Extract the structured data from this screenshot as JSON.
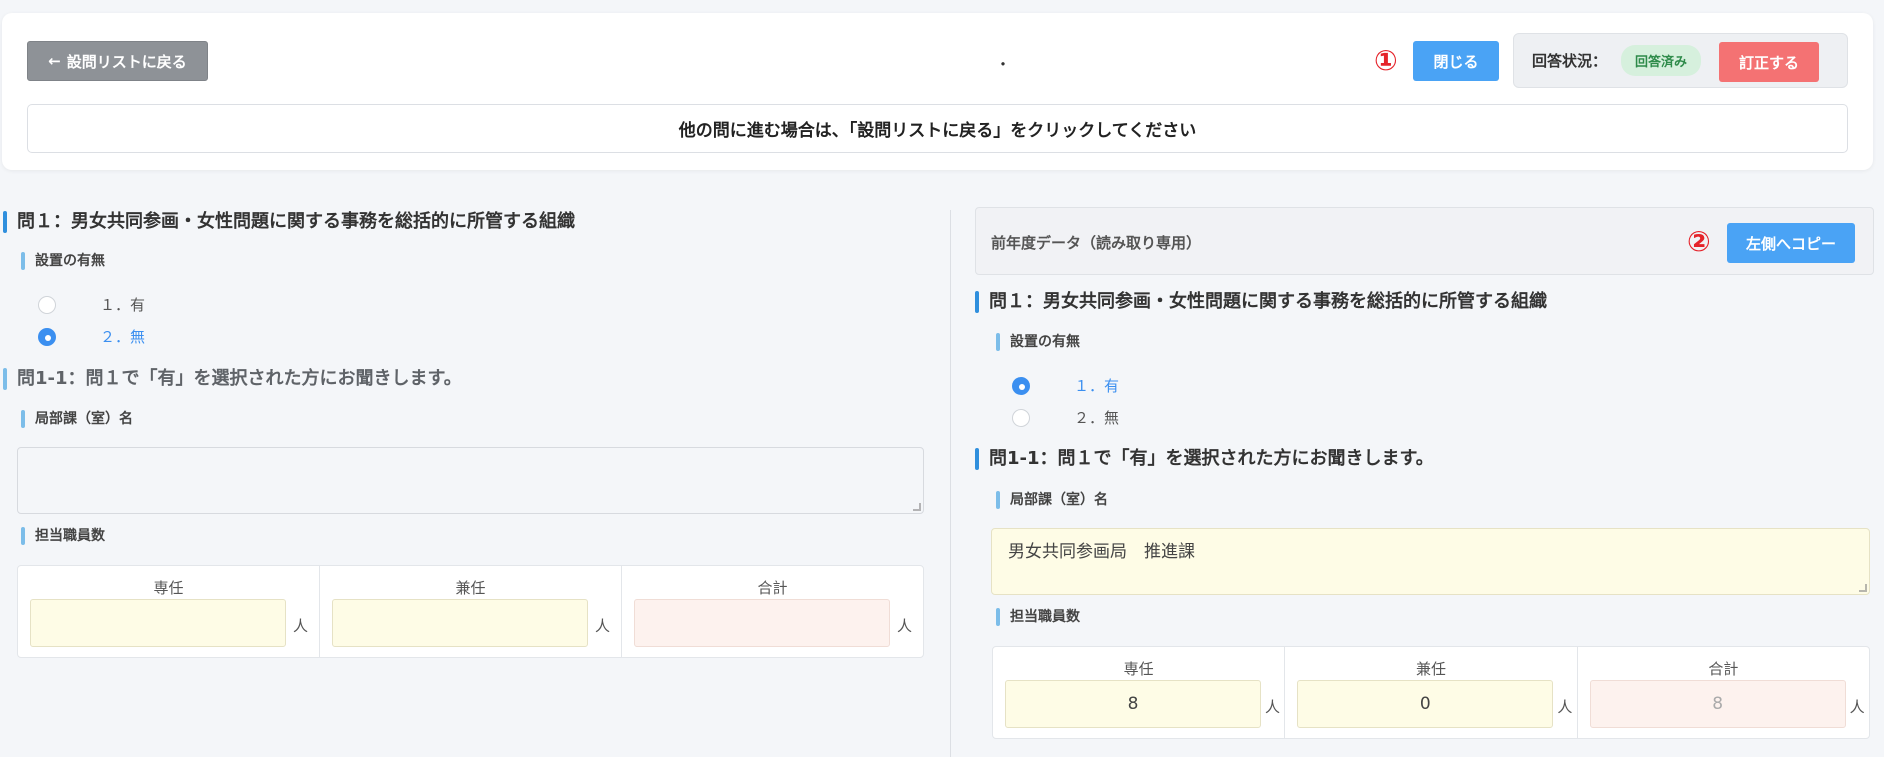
{
  "header": {
    "back_label": "設問リストに戻る",
    "center_dot": "・",
    "marker_1": "①",
    "close_label": "閉じる",
    "status_label": "回答状況：",
    "status_value": "回答済み",
    "correct_label": "訂正する",
    "notice": "他の問に進む場合は、「設問リストに戻る」をクリックしてください"
  },
  "left": {
    "q1_title": "問１：男女共同参画・女性問題に関する事務を総括的に所管する組織",
    "setup_label": "設置の有無",
    "options": [
      "１．有",
      "２．無"
    ],
    "selected_index": 1,
    "q11_title": "問1-1：問１で「有」を選択された方にお聞きします。",
    "dept_label": "局部課（室）名",
    "dept_value": "",
    "staff_label": "担当職員数",
    "columns": [
      "専任",
      "兼任",
      "合計"
    ],
    "values": [
      "",
      "",
      ""
    ],
    "unit": "人"
  },
  "right": {
    "header_title": "前年度データ（読み取り専用）",
    "marker_2": "②",
    "copy_label": "左側へコピー",
    "q1_title": "問１：男女共同参画・女性問題に関する事務を総括的に所管する組織",
    "setup_label": "設置の有無",
    "options": [
      "１．有",
      "２．無"
    ],
    "selected_index": 0,
    "q11_title": "問1-1：問１で「有」を選択された方にお聞きします。",
    "dept_label": "局部課（室）名",
    "dept_value": "男女共同参画局　推進課",
    "staff_label": "担当職員数",
    "columns": [
      "専任",
      "兼任",
      "合計"
    ],
    "values": [
      "8",
      "0",
      "8"
    ],
    "unit": "人"
  },
  "colors": {
    "primary": "#4aa3f5",
    "danger": "#f47273",
    "success_bg": "#d6f0dd",
    "marker": "#e5232a"
  }
}
